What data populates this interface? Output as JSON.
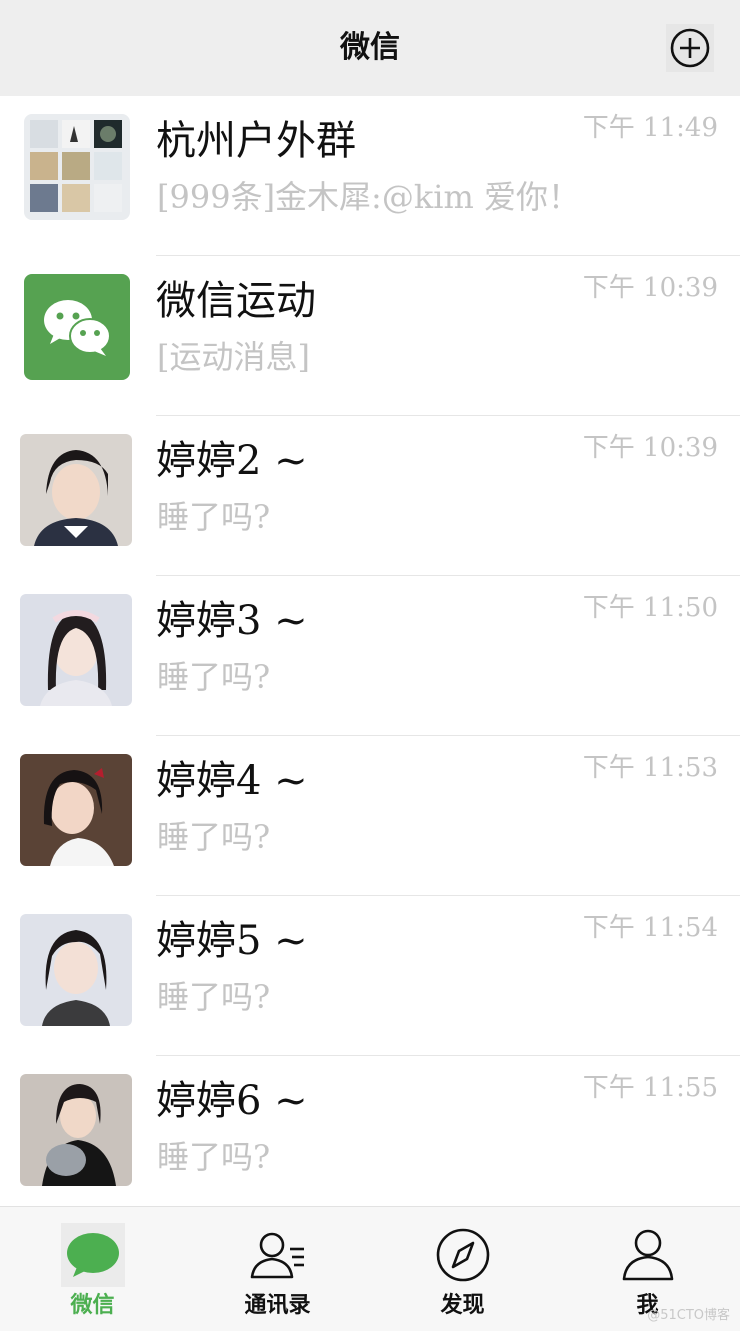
{
  "header": {
    "title": "微信"
  },
  "chats": [
    {
      "name": "杭州户外群",
      "preview": "[999条]金木犀:@kim 爱你！",
      "time": "下午 11:49",
      "avatar": "group-photo-grid"
    },
    {
      "name": "微信运动",
      "preview": "[运动消息]",
      "time": "下午 10:39",
      "avatar": "wechat-logo"
    },
    {
      "name": "婷婷2 ~",
      "preview": "睡了吗?",
      "time": "下午 10:39",
      "avatar": "portrait-photo"
    },
    {
      "name": "婷婷3 ~",
      "preview": "睡了吗?",
      "time": "下午 11:50",
      "avatar": "portrait-photo"
    },
    {
      "name": "婷婷4 ~",
      "preview": "睡了吗?",
      "time": "下午 11:53",
      "avatar": "portrait-photo"
    },
    {
      "name": "婷婷5 ~",
      "preview": "睡了吗?",
      "time": "下午 11:54",
      "avatar": "portrait-photo"
    },
    {
      "name": "婷婷6 ~",
      "preview": "睡了吗?",
      "time": "下午 11:55",
      "avatar": "portrait-photo"
    }
  ],
  "tabs": [
    {
      "label": "微信",
      "icon": "chat-bubble-icon",
      "active": true
    },
    {
      "label": "通讯录",
      "icon": "contacts-icon",
      "active": false
    },
    {
      "label": "发现",
      "icon": "compass-icon",
      "active": false
    },
    {
      "label": "我",
      "icon": "person-icon",
      "active": false
    }
  ],
  "colors": {
    "accent": "#4caf50",
    "header_bg": "#eeeeee",
    "tabbar_bg": "#f7f7f7",
    "muted_text": "#c4c4c4"
  },
  "watermark": "@51CTO博客"
}
